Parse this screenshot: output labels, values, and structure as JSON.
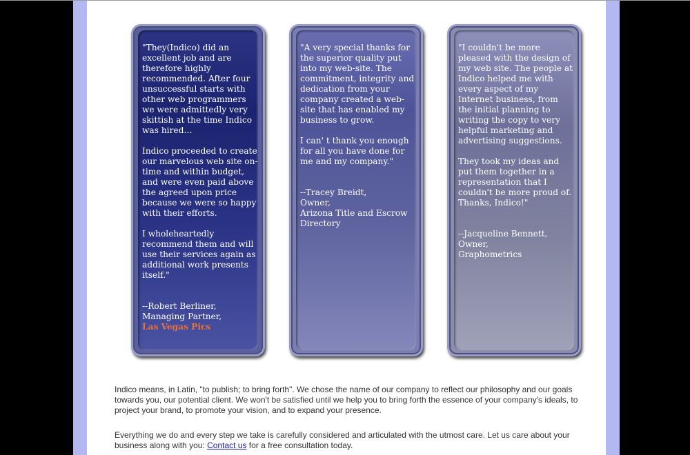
{
  "testimonials": [
    {
      "paragraphs": [
        "\"They(Indico) did an excellent job and are therefore highly recommended. After four unsuccessful starts with other web programmers we were admittedly very skittish at the time Indico was hired…",
        "Indico proceeded to create our marvelous web site on-time and within budget, and were even paid above the agreed upon price because we were so happy with their efforts.",
        "I wholeheartedly recommend them and will use their services again as additional work presents itself.\""
      ],
      "signature": {
        "name": "--Robert Berliner,",
        "title": "Managing Partner,",
        "company": "Las Vegas Pics"
      }
    },
    {
      "paragraphs": [
        "\"A very special thanks for the superior quality put into my web-site. The commitment, integrity and dedication from your company created a web-site that has enabled my business to grow.",
        "I can' t thank you enough for all you have done for me and my company.\""
      ],
      "signature": {
        "name": "--Tracey Breidt,",
        "title": "Owner,",
        "company": "Arizona Title and Escrow Directory"
      }
    },
    {
      "paragraphs": [
        "\"I couldn't be more pleased with the design of my web site. The people at Indico helped me with every aspect of my Internet business, from the initial planning to writing the copy to very helpful marketing and advertising suggestions.",
        "They took my ideas and put them together in a representation that I couldn't be more proud of. Thanks, Indico!\""
      ],
      "signature": {
        "name": "--Jacqueline Bennett,",
        "title": "Owner,",
        "company": "Graphometrics"
      }
    }
  ],
  "about": {
    "paragraph1": "Indico means, in Latin, \"to publish; to bring forth\". We chose the name of our company to reflect our philosophy and our goals towards you, our potential client. We won't be satisfied until we help you to bring forth the essence of your company's ideals, to project your brand, to promote your vision, and to expand your presence.",
    "paragraph2_before": "Everything we do and every step we take is carefully considered and articulated with the utmost care. Let us care about your business along with you: ",
    "contact_link": "Contact us",
    "paragraph2_after": " for a free consultation today."
  },
  "colors": {
    "link_accent": "#e8733a",
    "side_border": "#b3b8f2",
    "hyperlink": "#1a1aa8"
  }
}
